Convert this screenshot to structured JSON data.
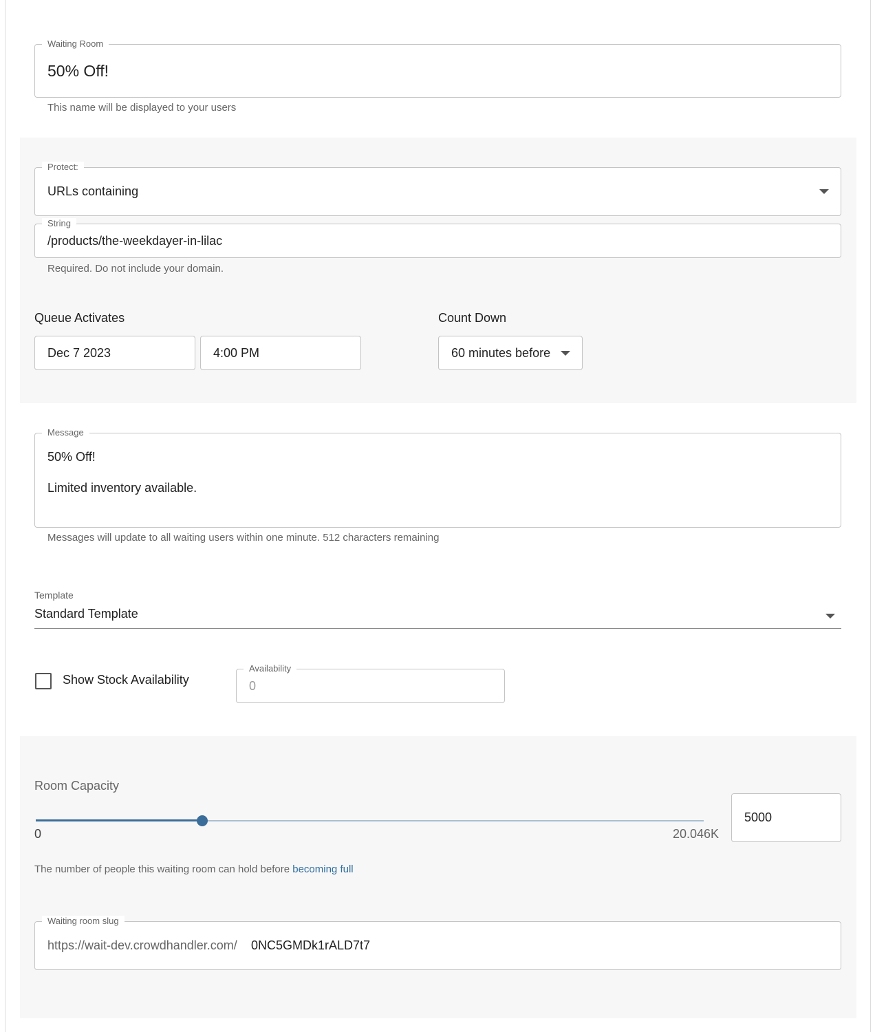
{
  "waiting_room": {
    "legend": "Waiting Room",
    "value": "50% Off!",
    "helper": "This name will be displayed to your users"
  },
  "protect": {
    "legend": "Protect:",
    "value": "URLs containing"
  },
  "string_field": {
    "legend": "String",
    "value": "/products/the-weekdayer-in-lilac",
    "helper": "Required. Do not include your domain."
  },
  "queue": {
    "label": "Queue Activates",
    "date": "Dec 7 2023",
    "time": "4:00 PM"
  },
  "countdown": {
    "label": "Count Down",
    "value": "60 minutes before"
  },
  "message": {
    "legend": "Message",
    "line1": "50% Off!",
    "line2": "Limited inventory available.",
    "helper": "Messages will update to all waiting users within one minute. 512 characters remaining"
  },
  "template": {
    "label": "Template",
    "value": "Standard Template"
  },
  "stock": {
    "checkbox_label": "Show Stock Availability",
    "checked": false,
    "availability_legend": "Availability",
    "availability_placeholder": "0"
  },
  "capacity": {
    "label": "Room Capacity",
    "slider_min_label": "0",
    "slider_max_label": "20.046K",
    "slider_min": 0,
    "slider_max": 20046,
    "slider_value": 5000,
    "input_value": "5000",
    "helper_prefix": "The number of people this waiting room can hold before",
    "helper_link": "becoming full"
  },
  "slug": {
    "legend": "Waiting room slug",
    "prefix": "https://wait-dev.crowdhandler.com/",
    "value": "0NC5GMDk1rALD7t7"
  },
  "colors": {
    "accent": "#3a6d9a",
    "link": "#2f6ea0",
    "section_bg": "#f7f7f7",
    "border": "#c4c4c4"
  }
}
